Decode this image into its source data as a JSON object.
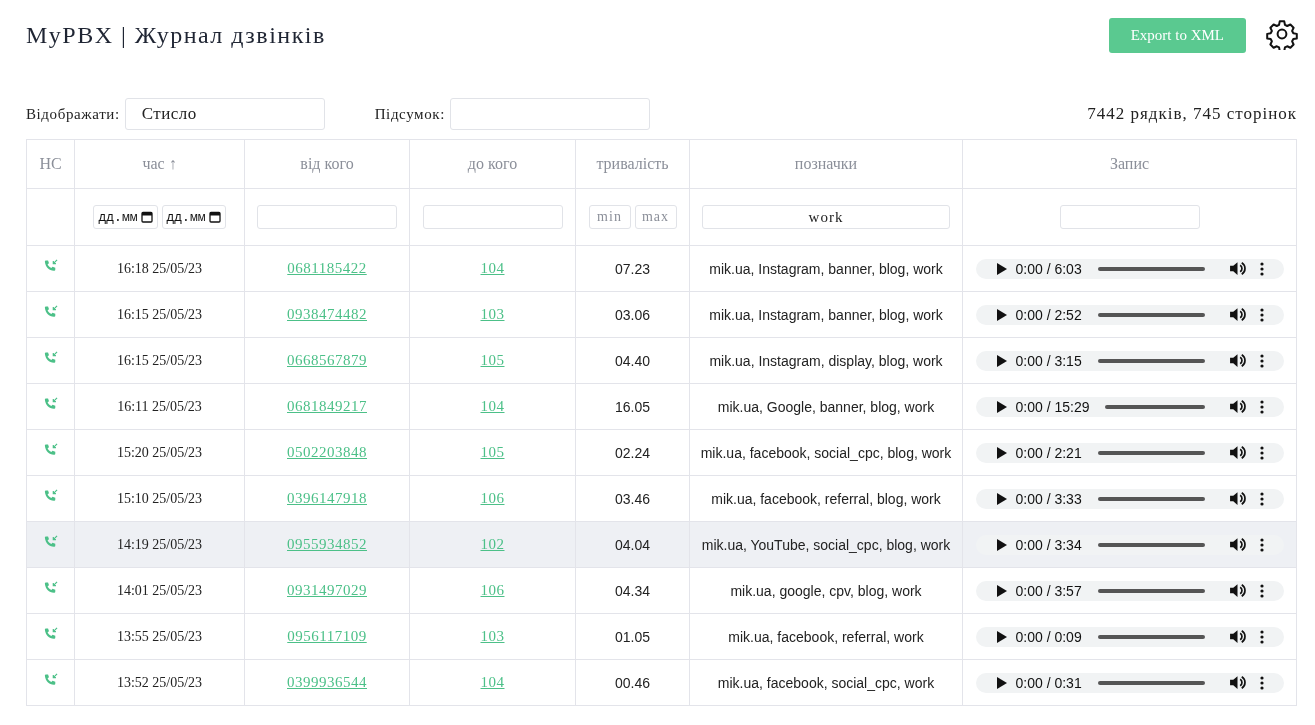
{
  "header": {
    "title": "MyPBX | Журнал дзвінків",
    "export_button": "Export to XML"
  },
  "toolbar": {
    "display_label": "Відображати:",
    "display_value": "Стисло",
    "summary_label": "Підсумок:",
    "count": "7442 рядків, 745 сторінок"
  },
  "table": {
    "columns": [
      {
        "label": "НС"
      },
      {
        "label": "час ↑"
      },
      {
        "label": "від кого"
      },
      {
        "label": "до кого"
      },
      {
        "label": "тривалість"
      },
      {
        "label": "позначки"
      },
      {
        "label": "Запис"
      }
    ],
    "filters": {
      "date_from": {
        "placeholder": "дд.мм"
      },
      "date_to": {
        "placeholder": "дд.мм"
      },
      "duration_min": {
        "placeholder": "min"
      },
      "duration_max": {
        "placeholder": "max"
      },
      "tags": {
        "value": "work"
      }
    },
    "rows": [
      {
        "time": "16:18 25/05/23",
        "from": "0681185422",
        "to": "104",
        "duration": "07.23",
        "tags": "mik.ua, Instagram, banner, blog, work",
        "player_time": "0:00 / 6:03",
        "highlighted": false
      },
      {
        "time": "16:15 25/05/23",
        "from": "0938474482",
        "to": "103",
        "duration": "03.06",
        "tags": "mik.ua, Instagram, banner, blog, work",
        "player_time": "0:00 / 2:52",
        "highlighted": false
      },
      {
        "time": "16:15 25/05/23",
        "from": "0668567879",
        "to": "105",
        "duration": "04.40",
        "tags": "mik.ua, Instagram, display, blog, work",
        "player_time": "0:00 / 3:15",
        "highlighted": false
      },
      {
        "time": "16:11 25/05/23",
        "from": "0681849217",
        "to": "104",
        "duration": "16.05",
        "tags": "mik.ua, Google, banner, blog, work",
        "player_time": "0:00 / 15:29",
        "highlighted": false
      },
      {
        "time": "15:20 25/05/23",
        "from": "0502203848",
        "to": "105",
        "duration": "02.24",
        "tags": "mik.ua, facebook, social_cpc, blog, work",
        "player_time": "0:00 / 2:21",
        "highlighted": false
      },
      {
        "time": "15:10 25/05/23",
        "from": "0396147918",
        "to": "106",
        "duration": "03.46",
        "tags": "mik.ua, facebook, referral, blog, work",
        "player_time": "0:00 / 3:33",
        "highlighted": false
      },
      {
        "time": "14:19 25/05/23",
        "from": "0955934852",
        "to": "102",
        "duration": "04.04",
        "tags": "mik.ua, YouTube, social_cpc, blog, work",
        "player_time": "0:00 / 3:34",
        "highlighted": true
      },
      {
        "time": "14:01 25/05/23",
        "from": "0931497029",
        "to": "106",
        "duration": "04.34",
        "tags": "mik.ua, google, cpv, blog, work",
        "player_time": "0:00 / 3:57",
        "highlighted": false
      },
      {
        "time": "13:55 25/05/23",
        "from": "0956117109",
        "to": "103",
        "duration": "01.05",
        "tags": "mik.ua, facebook, referral, work",
        "player_time": "0:00 / 0:09",
        "highlighted": false
      },
      {
        "time": "13:52 25/05/23",
        "from": "0399936544",
        "to": "104",
        "duration": "00.46",
        "tags": "mik.ua, facebook, social_cpc, work",
        "player_time": "0:00 / 0:31",
        "highlighted": false
      }
    ]
  }
}
